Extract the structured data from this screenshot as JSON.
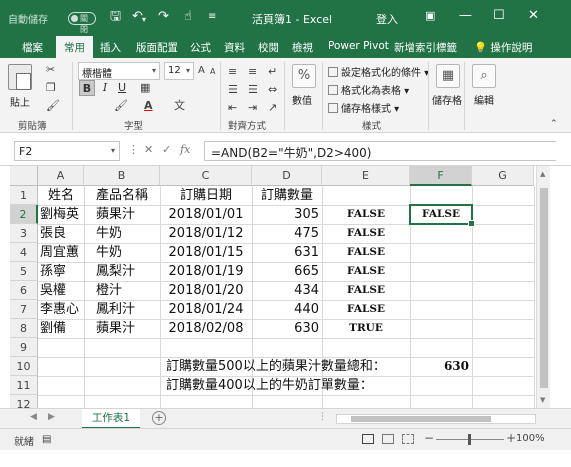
{
  "titlebar": {
    "autosave_label": "自動儲存",
    "autosave_state": "關閉",
    "doc_title": "活頁簿1 - Excel",
    "signin": "登入",
    "qa_icons": [
      "save-icon",
      "undo-icon",
      "redo-icon",
      "touch-mode-icon",
      "customize-qat-icon"
    ],
    "window_buttons": [
      "ribbon-display-icon",
      "minimize-icon",
      "restore-icon",
      "close-icon"
    ]
  },
  "ribbon_tabs": [
    "檔案",
    "常用",
    "插入",
    "版面配置",
    "公式",
    "資料",
    "校閱",
    "檢視",
    "Power Pivot",
    "新增索引標籤"
  ],
  "active_tab": "常用",
  "tell_me": "操作說明",
  "ribbon": {
    "clipboard": {
      "paste": "貼上",
      "label": "剪貼簿"
    },
    "font": {
      "name": "標楷體",
      "size": "12",
      "label": "字型",
      "bold": "B",
      "italic": "I",
      "underline": "U",
      "grow": "A",
      "shrink": "A"
    },
    "alignment": {
      "label": "對齊方式"
    },
    "number": {
      "button": "數值",
      "symbol": "%"
    },
    "styles": {
      "conditional": "設定格式化的條件",
      "table": "格式化為表格",
      "cell_styles": "儲存格樣式",
      "label": "樣式"
    },
    "cells": {
      "button": "儲存格"
    },
    "editing": {
      "button": "編輯"
    }
  },
  "formula_bar": {
    "name_box": "F2",
    "formula": "=AND(B2=\"牛奶\",D2>400)",
    "fx": "fx"
  },
  "columns": [
    "A",
    "B",
    "C",
    "D",
    "E",
    "F",
    "G"
  ],
  "selected_column": "F",
  "rows": [
    "1",
    "2",
    "3",
    "4",
    "5",
    "6",
    "7",
    "8",
    "9",
    "10",
    "11",
    "12"
  ],
  "selected_row": "2",
  "sheet": {
    "headers": [
      "姓名",
      "產品名稱",
      "訂購日期",
      "訂購數量"
    ],
    "data": [
      {
        "name": "劉梅英",
        "product": "蘋果汁",
        "date": "2018/01/01",
        "qty": "305",
        "result": "FALSE"
      },
      {
        "name": "張良",
        "product": "牛奶",
        "date": "2018/01/12",
        "qty": "475",
        "result": "FALSE"
      },
      {
        "name": "周宜蕙",
        "product": "牛奶",
        "date": "2018/01/15",
        "qty": "631",
        "result": "FALSE"
      },
      {
        "name": "孫寧",
        "product": "鳳梨汁",
        "date": "2018/01/19",
        "qty": "665",
        "result": "FALSE"
      },
      {
        "name": "吳權",
        "product": "橙汁",
        "date": "2018/01/20",
        "qty": "434",
        "result": "FALSE"
      },
      {
        "name": "李惠心",
        "product": "鳳利汁",
        "date": "2018/01/24",
        "qty": "440",
        "result": "FALSE"
      },
      {
        "name": "劉備",
        "product": "蘋果汁",
        "date": "2018/02/08",
        "qty": "630",
        "result": "TRUE"
      }
    ],
    "f2": "FALSE",
    "summary1_label": "訂購數量500以上的蘋果汁數量總和：",
    "summary1_value": "630",
    "summary2_label": "訂購數量400以上的牛奶訂單數量："
  },
  "sheet_tab": "工作表1",
  "status": {
    "mode": "就緒",
    "zoom": "100%"
  }
}
